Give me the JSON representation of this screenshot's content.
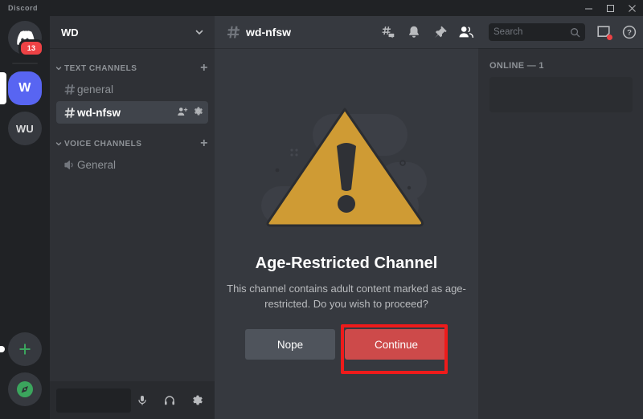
{
  "window": {
    "app_title": "Discord",
    "controls": [
      {
        "name": "minimize",
        "glyph": "minimize-icon"
      },
      {
        "name": "maximize",
        "glyph": "maximize-icon"
      },
      {
        "name": "close",
        "glyph": "close-icon"
      }
    ]
  },
  "server_rail": {
    "home": {
      "label": "Discord",
      "badge": "13"
    },
    "servers": [
      {
        "label": "W",
        "active": true,
        "style": "blurple"
      },
      {
        "label": "WU",
        "active": false,
        "style": "grey"
      }
    ],
    "add_server_label": "+",
    "explore_label": "compass-icon"
  },
  "sidebar": {
    "guild_name": "WD",
    "categories": [
      {
        "label": "TEXT CHANNELS",
        "add_label": "+",
        "channels": [
          {
            "name": "general",
            "active": false,
            "nsfw": false
          },
          {
            "name": "wd-nfsw",
            "active": true,
            "nsfw": true
          }
        ]
      },
      {
        "label": "VOICE CHANNELS",
        "add_label": "+",
        "channels": [
          {
            "name": "General",
            "active": false,
            "voice": true
          }
        ]
      }
    ],
    "user_panel": {
      "mic_label": "microphone-icon",
      "headset_label": "headphones-icon",
      "settings_label": "user-settings-icon"
    }
  },
  "channel_header": {
    "title": "wd-nfsw",
    "icons": [
      {
        "name": "threads-icon"
      },
      {
        "name": "notifications-bell-icon"
      },
      {
        "name": "pinned-messages-icon"
      },
      {
        "name": "member-list-icon"
      }
    ],
    "search": {
      "placeholder": "Search",
      "value": ""
    },
    "inbox_label": "inbox-icon",
    "help_label": "?"
  },
  "nsfw_gate": {
    "illustration": "warning-triangle",
    "title": "Age-Restricted Channel",
    "description": "This channel contains adult content marked as age-restricted. Do you wish to proceed?",
    "decline_label": "Nope",
    "accept_label": "Continue"
  },
  "members": {
    "header": "ONLINE — 1"
  },
  "colors": {
    "accent_blurple": "#5865f2",
    "danger_red": "#cd4a4a",
    "annotation_red": "#ee1b1b",
    "warning_amber": "#cf9b34",
    "badge_red": "#ed4245",
    "online_green": "#3ba55d",
    "rail_bg": "#202225",
    "sidebar_bg": "#2f3136",
    "content_bg": "#36393f"
  }
}
